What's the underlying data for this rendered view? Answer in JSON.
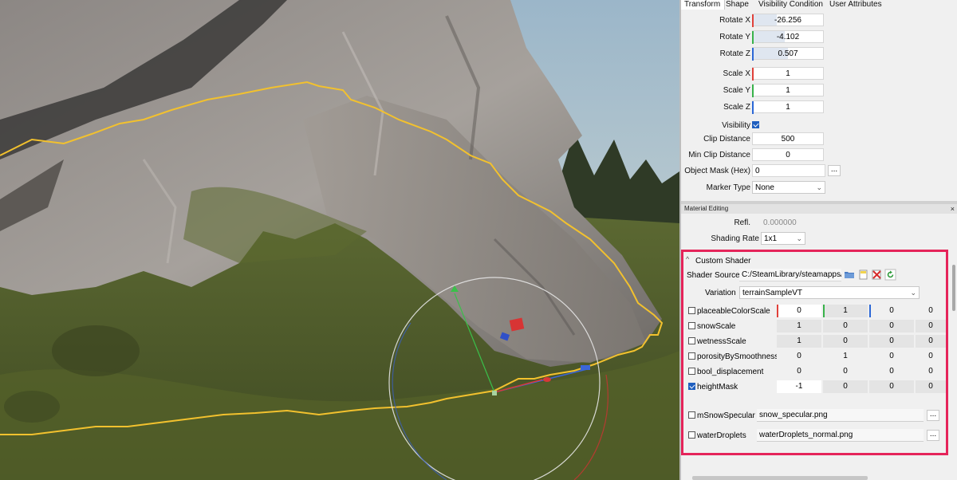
{
  "colors": {
    "axis_x": "#e0413a",
    "axis_y": "#38b24a",
    "axis_z": "#2b67d6",
    "highlight": "#e5245a",
    "checkbox": "#1f5fbf"
  },
  "properties": {
    "tabs": [
      "Transform",
      "Shape",
      "Visibility Condition",
      "User Attributes"
    ],
    "rotate_x": {
      "label": "Rotate X",
      "value": "-26.256"
    },
    "rotate_y": {
      "label": "Rotate Y",
      "value": "-4.102"
    },
    "rotate_z": {
      "label": "Rotate Z",
      "value": "0.507"
    },
    "scale_x": {
      "label": "Scale X",
      "value": "1"
    },
    "scale_y": {
      "label": "Scale Y",
      "value": "1"
    },
    "scale_z": {
      "label": "Scale Z",
      "value": "1"
    },
    "visibility": {
      "label": "Visibility",
      "checked": true
    },
    "clip_distance": {
      "label": "Clip Distance",
      "value": "500"
    },
    "min_clip_distance": {
      "label": "Min Clip Distance",
      "value": "0"
    },
    "object_mask": {
      "label": "Object Mask (Hex)",
      "value": "0",
      "button": "..."
    },
    "marker_type": {
      "label": "Marker Type",
      "value": "None"
    }
  },
  "material": {
    "panel_title": "Material Editing",
    "close_glyph": "×",
    "refl": {
      "label": "Refl.",
      "value": "0.000000"
    },
    "shading_rate": {
      "label": "Shading Rate",
      "value": "1x1"
    },
    "custom_shader": {
      "title": "Custom Shader",
      "collapse_glyph": "^",
      "shader_source": {
        "label": "Shader Source",
        "value": "C:/SteamLibrary/steamapps/comm"
      },
      "variation": {
        "label": "Variation",
        "value": "terrainSampleVT"
      },
      "params": [
        {
          "name": "placeableColorScale",
          "checked": false,
          "values": [
            "0",
            "1",
            "0",
            "0"
          ]
        },
        {
          "name": "snowScale",
          "checked": false,
          "values": [
            "1",
            "0",
            "0",
            "0"
          ]
        },
        {
          "name": "wetnessScale",
          "checked": false,
          "values": [
            "1",
            "0",
            "0",
            "0"
          ]
        },
        {
          "name": "porosityBySmoothness",
          "checked": false,
          "values": [
            "0",
            "1",
            "0",
            "0"
          ]
        },
        {
          "name": "bool_displacement",
          "checked": false,
          "values": [
            "0",
            "0",
            "0",
            "0"
          ]
        },
        {
          "name": "heightMask",
          "checked": true,
          "values": [
            "-1",
            "0",
            "0",
            "0"
          ]
        }
      ],
      "textures": [
        {
          "name": "mSnowSpecular",
          "checked": false,
          "file": "snow_specular.png",
          "button": "..."
        },
        {
          "name": "waterDroplets",
          "checked": false,
          "file": "waterDroplets_normal.png",
          "button": "..."
        }
      ]
    }
  }
}
